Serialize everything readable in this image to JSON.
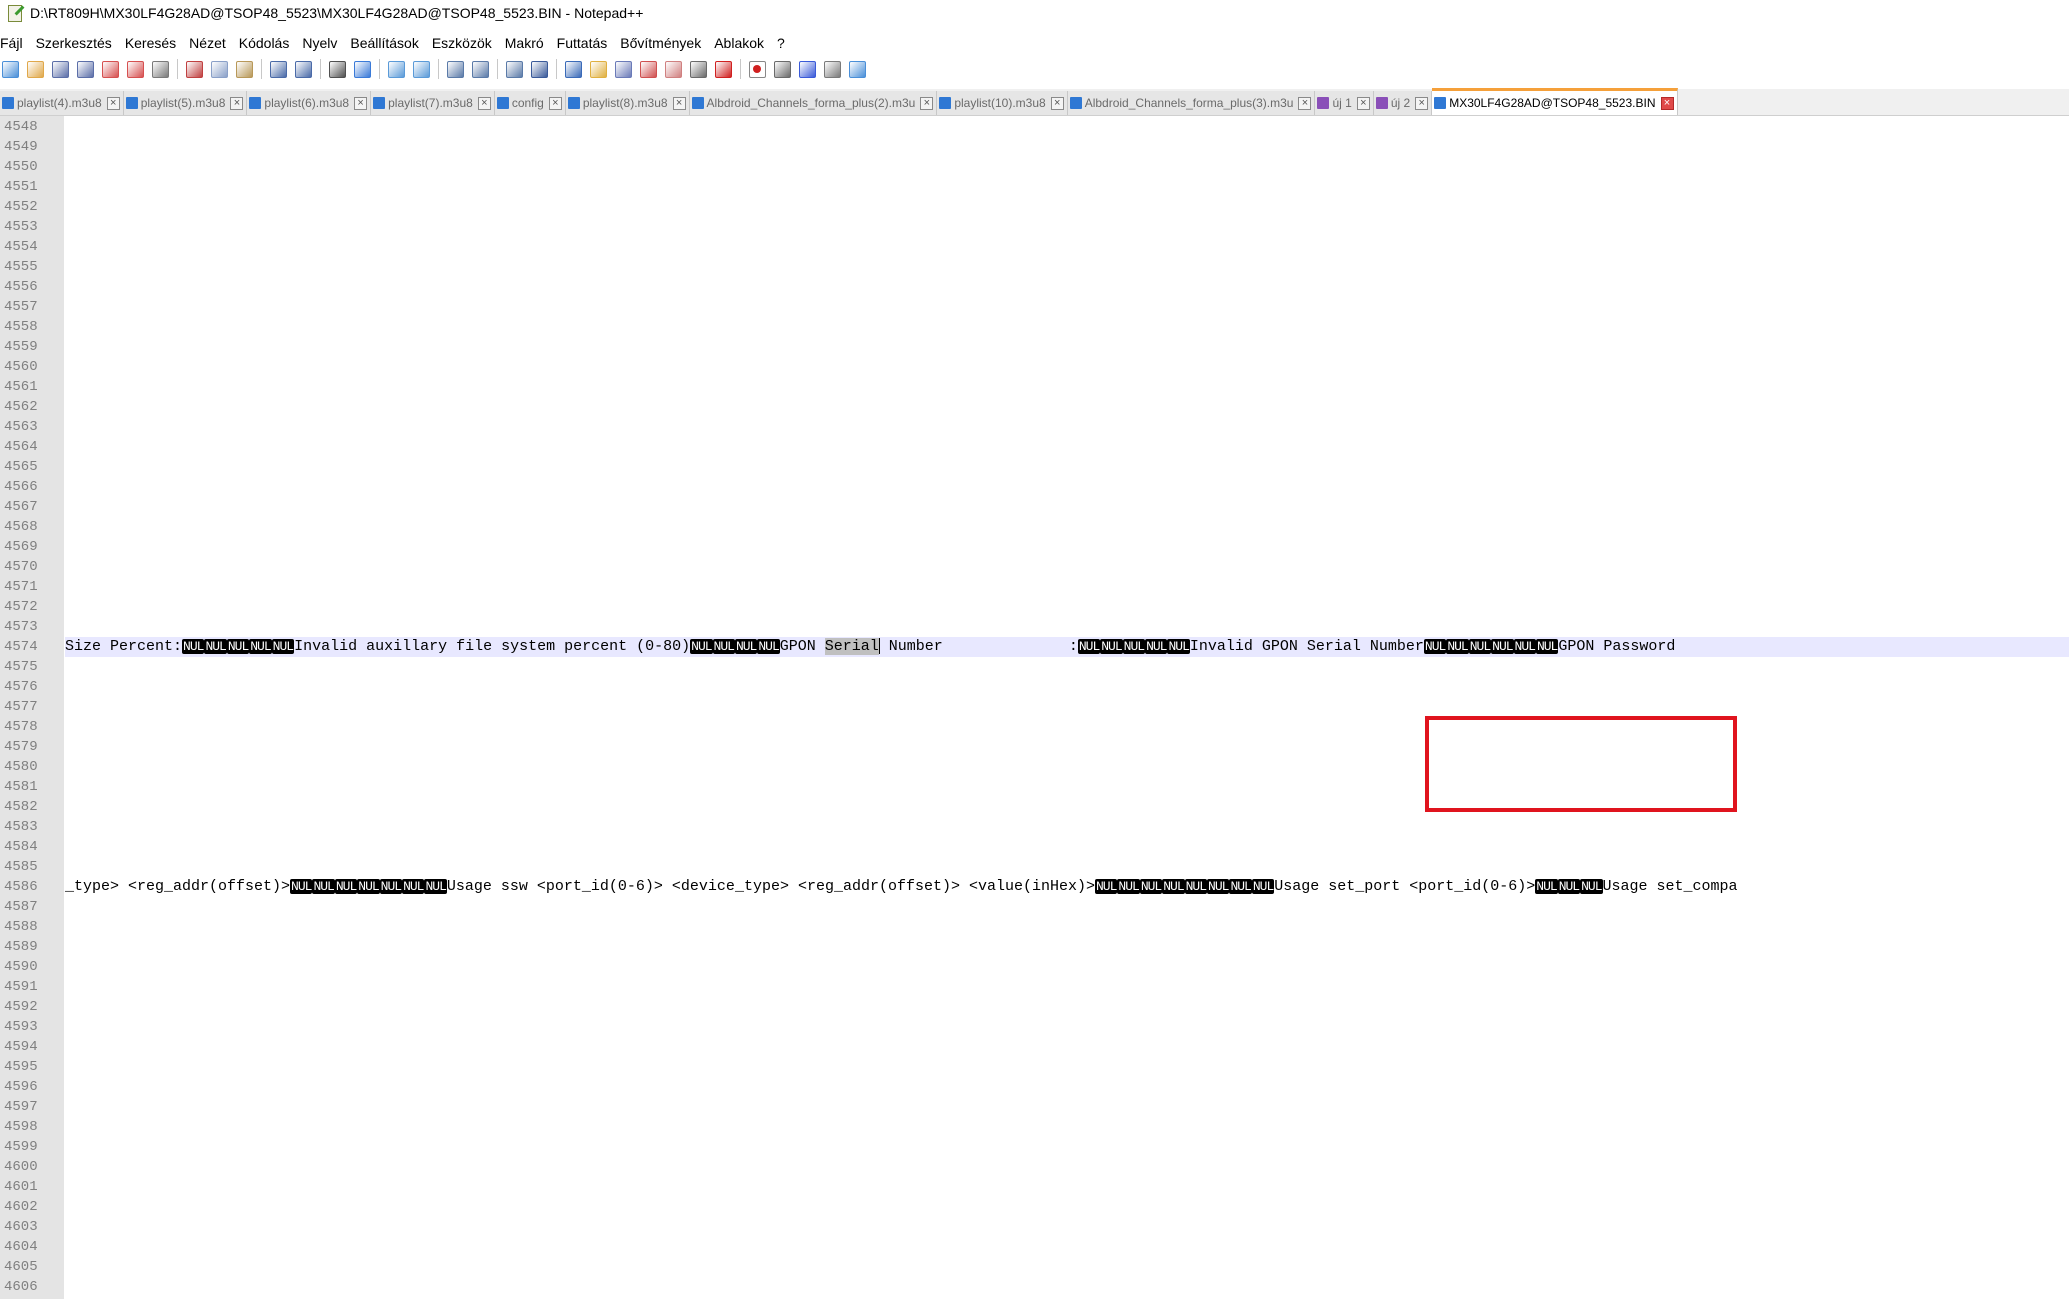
{
  "window": {
    "title": "D:\\RT809H\\MX30LF4G28AD@TSOP48_5523\\MX30LF4G28AD@TSOP48_5523.BIN - Notepad++"
  },
  "menu": [
    "Fájl",
    "Szerkesztés",
    "Keresés",
    "Nézet",
    "Kódolás",
    "Nyelv",
    "Beállítások",
    "Eszközök",
    "Makró",
    "Futtatás",
    "Bővítmények",
    "Ablakok",
    "?"
  ],
  "toolbar": {
    "icons": [
      "new-file-icon",
      "open-file-icon",
      "save-icon",
      "save-all-icon",
      "close-icon",
      "close-all-icon",
      "print-icon",
      "|",
      "cut-icon",
      "copy-icon",
      "paste-icon",
      "|",
      "undo-icon",
      "redo-icon",
      "|",
      "find-icon",
      "replace-icon",
      "|",
      "zoom-in-icon",
      "zoom-out-icon",
      "|",
      "sync-vertical-icon",
      "sync-horizontal-icon",
      "|",
      "word-wrap-icon",
      "show-all-chars-icon",
      "|",
      "indent-guide-icon",
      "udl-icon",
      "doc-map-icon",
      "function-list-icon",
      "folder-workspace-icon",
      "folder-icon",
      "monitor-icon",
      "|",
      "record-macro-icon",
      "stop-macro-icon",
      "play-macro-icon",
      "run-macro-multiple-icon",
      "save-macro-icon"
    ]
  },
  "tabs": [
    {
      "label": "playlist(4).m3u8",
      "color": "#2f78d4",
      "active": false
    },
    {
      "label": "playlist(5).m3u8",
      "color": "#2f78d4",
      "active": false
    },
    {
      "label": "playlist(6).m3u8",
      "color": "#2f78d4",
      "active": false
    },
    {
      "label": "playlist(7).m3u8",
      "color": "#2f78d4",
      "active": false
    },
    {
      "label": "config",
      "color": "#2f78d4",
      "active": false
    },
    {
      "label": "playlist(8).m3u8",
      "color": "#2f78d4",
      "active": false
    },
    {
      "label": "Albdroid_Channels_forma_plus(2).m3u",
      "color": "#2f78d4",
      "active": false
    },
    {
      "label": "playlist(10).m3u8",
      "color": "#2f78d4",
      "active": false
    },
    {
      "label": "Albdroid_Channels_forma_plus(3).m3u",
      "color": "#2f78d4",
      "active": false
    },
    {
      "label": "új 1",
      "color": "#8a4fb8",
      "active": false
    },
    {
      "label": "új 2",
      "color": "#8a4fb8",
      "active": false
    },
    {
      "label": "MX30LF4G28AD@TSOP48_5523.BIN",
      "color": "#2f78d4",
      "active": true
    }
  ],
  "editor": {
    "first_line": 4548,
    "last_line": 4606,
    "line_4574": {
      "number": 4574,
      "segments": [
        {
          "t": "text",
          "v": "Size Percent:"
        },
        {
          "t": "nul",
          "v": "NUL"
        },
        {
          "t": "nul",
          "v": "NUL"
        },
        {
          "t": "nul",
          "v": "NUL"
        },
        {
          "t": "nul",
          "v": "NUL"
        },
        {
          "t": "nul",
          "v": "NUL"
        },
        {
          "t": "text",
          "v": "Invalid auxillary file system percent (0-80)"
        },
        {
          "t": "nul",
          "v": "NUL"
        },
        {
          "t": "nul",
          "v": "NUL"
        },
        {
          "t": "nul",
          "v": "NUL"
        },
        {
          "t": "nul",
          "v": "NUL"
        },
        {
          "t": "text",
          "v": "GPON "
        },
        {
          "t": "sel",
          "v": "Serial"
        },
        {
          "t": "text",
          "v": " Number              :"
        },
        {
          "t": "nul",
          "v": "NUL"
        },
        {
          "t": "nul",
          "v": "NUL"
        },
        {
          "t": "nul",
          "v": "NUL"
        },
        {
          "t": "nul",
          "v": "NUL"
        },
        {
          "t": "nul",
          "v": "NUL"
        },
        {
          "t": "text",
          "v": "Invalid GPON Serial Number"
        },
        {
          "t": "nul",
          "v": "NUL"
        },
        {
          "t": "nul",
          "v": "NUL"
        },
        {
          "t": "nul",
          "v": "NUL"
        },
        {
          "t": "nul",
          "v": "NUL"
        },
        {
          "t": "nul",
          "v": "NUL"
        },
        {
          "t": "nul",
          "v": "NUL"
        },
        {
          "t": "text",
          "v": "GPON Password"
        }
      ]
    },
    "line_4586": {
      "number": 4586,
      "segments": [
        {
          "t": "text",
          "v": "_type> <reg_addr(offset)>"
        },
        {
          "t": "nul",
          "v": "NUL"
        },
        {
          "t": "nul",
          "v": "NUL"
        },
        {
          "t": "nul",
          "v": "NUL"
        },
        {
          "t": "nul",
          "v": "NUL"
        },
        {
          "t": "nul",
          "v": "NUL"
        },
        {
          "t": "nul",
          "v": "NUL"
        },
        {
          "t": "nul",
          "v": "NUL"
        },
        {
          "t": "text",
          "v": "Usage ssw <port_id(0-6)> <device_type> <reg_addr(offset)> <value(inHex)>"
        },
        {
          "t": "nul",
          "v": "NUL"
        },
        {
          "t": "nul",
          "v": "NUL"
        },
        {
          "t": "nul",
          "v": "NUL"
        },
        {
          "t": "nul",
          "v": "NUL"
        },
        {
          "t": "nul",
          "v": "NUL"
        },
        {
          "t": "nul",
          "v": "NUL"
        },
        {
          "t": "nul",
          "v": "NUL"
        },
        {
          "t": "nul",
          "v": "NUL"
        },
        {
          "t": "text",
          "v": "Usage set_port <port_id(0-6)>"
        },
        {
          "t": "nul",
          "v": "NUL"
        },
        {
          "t": "nul",
          "v": "NUL"
        },
        {
          "t": "nul",
          "v": "NUL"
        },
        {
          "t": "text",
          "v": "Usage set_compa"
        }
      ]
    }
  },
  "colors": {
    "highlight_box": "#e0141e",
    "current_line_bg": "#e8e8ff",
    "active_tab_accent": "#f5a03a"
  }
}
